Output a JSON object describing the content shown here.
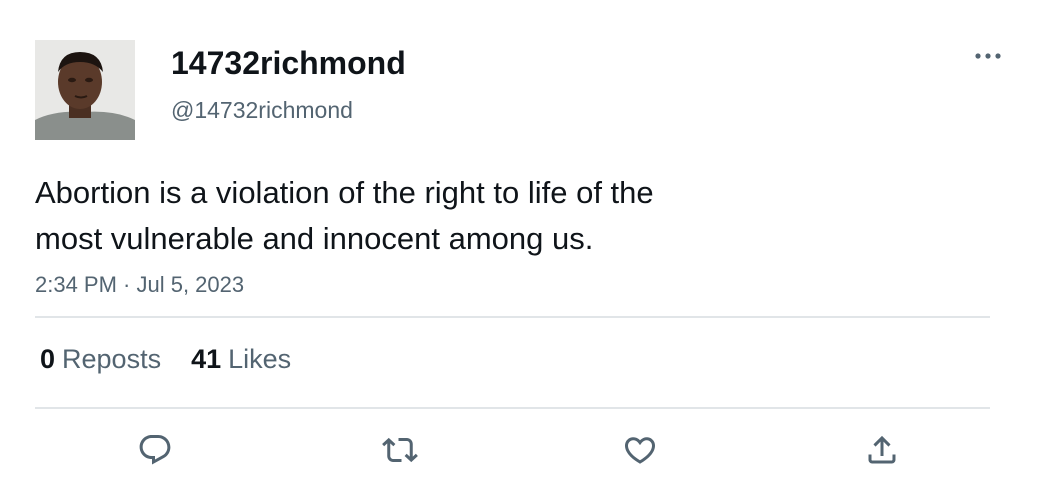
{
  "tweet": {
    "display_name": "14732richmond",
    "handle": "@14732richmond",
    "text_lines": [
      "Abortion is a violation of the right to life of the",
      "most vulnerable and innocent among us."
    ],
    "timestamp": "2:34 PM · Jul 5, 2023"
  },
  "stats": {
    "reposts_count": "0",
    "reposts_label": "Reposts",
    "likes_count": "41",
    "likes_label": "Likes"
  },
  "icons": {
    "more": "more-horizontal-icon",
    "reply": "reply-icon",
    "repost": "repost-icon",
    "like": "heart-icon",
    "share": "share-icon"
  },
  "colors": {
    "text": "#0f1419",
    "secondary": "#536471",
    "divider": "#e1e5e8"
  }
}
